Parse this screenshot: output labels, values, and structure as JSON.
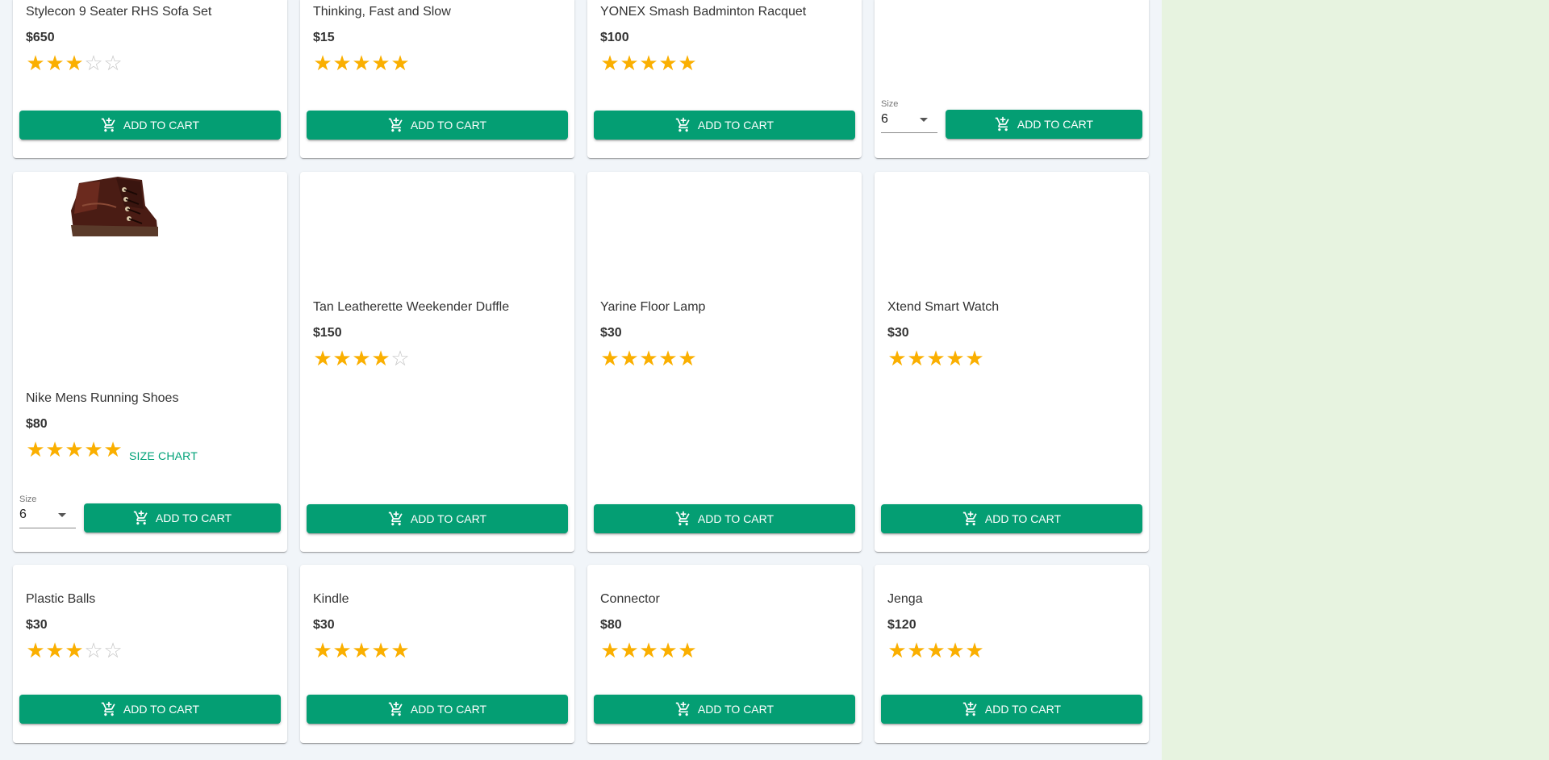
{
  "button_label": "ADD TO CART",
  "size_chart_label": "SIZE CHART",
  "size_field": {
    "label": "Size",
    "value": "6"
  },
  "colors": {
    "button": "#049e73",
    "star": "#faaf00",
    "link": "#00a278",
    "side_panel": "#e7f3e0"
  },
  "products": [
    {
      "name": "Stylecon 9 Seater RHS Sofa Set",
      "price": "$650",
      "rating": 3
    },
    {
      "name": "Thinking, Fast and Slow",
      "price": "$15",
      "rating": 5
    },
    {
      "name": "YONEX Smash Badminton Racquet",
      "price": "$100",
      "rating": 5
    },
    {
      "name": "",
      "price": "",
      "rating": null,
      "has_size": true
    },
    {
      "name": "Nike Mens Running Shoes",
      "price": "$80",
      "rating": 5,
      "has_size": true,
      "has_size_chart": true,
      "image": "boot"
    },
    {
      "name": "Tan Leatherette Weekender Duffle",
      "price": "$150",
      "rating": 4
    },
    {
      "name": "Yarine Floor Lamp",
      "price": "$30",
      "rating": 5
    },
    {
      "name": "Xtend Smart Watch",
      "price": "$30",
      "rating": 5
    },
    {
      "name": "Plastic Balls",
      "price": "$30",
      "rating": 3
    },
    {
      "name": "Kindle",
      "price": "$30",
      "rating": 5
    },
    {
      "name": "Connector",
      "price": "$80",
      "rating": 5
    },
    {
      "name": "Jenga",
      "price": "$120",
      "rating": 5
    }
  ]
}
